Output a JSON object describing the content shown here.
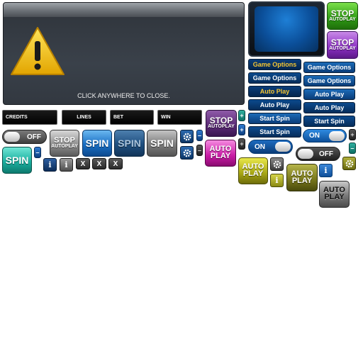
{
  "dialog": {
    "message": "CLICK ANYWHERE TO CLOSE.",
    "icon": "warning-icon"
  },
  "labels": {
    "credits": "CREDITS",
    "lines": "LINES",
    "bet": "BET",
    "win": "WIN"
  },
  "buttons": {
    "stop": "STOP",
    "autoplay": "AUTOPLAY",
    "spin": "SPIN",
    "auto": "AUTO",
    "play": "PLAY",
    "game_options": "Game Options",
    "auto_play": "Auto Play",
    "start_spin": "Start Spin",
    "off": "OFF",
    "on": "ON",
    "info": "i",
    "close": "X",
    "plus": "+",
    "minus": "–"
  }
}
